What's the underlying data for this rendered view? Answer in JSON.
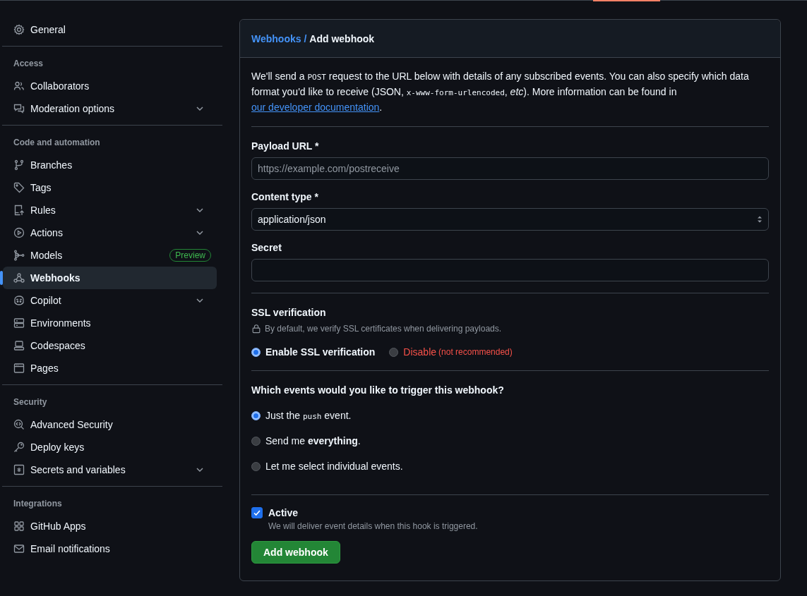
{
  "sidebar": {
    "sections": [
      {
        "items": [
          {
            "label": "General",
            "expandable": false,
            "selected": false
          }
        ]
      },
      {
        "heading": "Access",
        "items": [
          {
            "label": "Collaborators",
            "expandable": false,
            "selected": false
          },
          {
            "label": "Moderation options",
            "expandable": true,
            "selected": false
          }
        ]
      },
      {
        "heading": "Code and automation",
        "items": [
          {
            "label": "Branches",
            "expandable": false,
            "selected": false
          },
          {
            "label": "Tags",
            "expandable": false,
            "selected": false
          },
          {
            "label": "Rules",
            "expandable": true,
            "selected": false
          },
          {
            "label": "Actions",
            "expandable": true,
            "selected": false
          },
          {
            "label": "Models",
            "expandable": false,
            "selected": false,
            "badge": "Preview"
          },
          {
            "label": "Webhooks",
            "expandable": false,
            "selected": true
          },
          {
            "label": "Copilot",
            "expandable": true,
            "selected": false
          },
          {
            "label": "Environments",
            "expandable": false,
            "selected": false
          },
          {
            "label": "Codespaces",
            "expandable": false,
            "selected": false
          },
          {
            "label": "Pages",
            "expandable": false,
            "selected": false
          }
        ]
      },
      {
        "heading": "Security",
        "items": [
          {
            "label": "Advanced Security",
            "expandable": false,
            "selected": false
          },
          {
            "label": "Deploy keys",
            "expandable": false,
            "selected": false
          },
          {
            "label": "Secrets and variables",
            "expandable": true,
            "selected": false
          }
        ]
      },
      {
        "heading": "Integrations",
        "items": [
          {
            "label": "GitHub Apps",
            "expandable": false,
            "selected": false
          },
          {
            "label": "Email notifications",
            "expandable": false,
            "selected": false
          }
        ]
      }
    ]
  },
  "main": {
    "breadcrumb": {
      "parent": "Webhooks /",
      "current": "Add webhook"
    },
    "intro": [
      {
        "kind": "text",
        "text": "We'll send a "
      },
      {
        "kind": "code",
        "text": "POST"
      },
      {
        "kind": "text",
        "text": " request to the URL below with details of any subscribed events. You can also specify which data format you'd like to receive (JSON, "
      },
      {
        "kind": "code",
        "text": "x-www-form-urlencoded"
      },
      {
        "kind": "text",
        "text": ", "
      },
      {
        "kind": "italic",
        "text": "etc"
      },
      {
        "kind": "text",
        "text": "). More information can be found in "
      },
      {
        "kind": "link",
        "text": "our developer documentation"
      },
      {
        "kind": "text",
        "text": "."
      }
    ],
    "payload_url": {
      "label": "Payload URL *",
      "placeholder": "https://example.com/postreceive"
    },
    "content_type": {
      "label": "Content type *",
      "value": "application/json"
    },
    "secret": {
      "label": "Secret"
    },
    "ssl": {
      "heading": "SSL verification",
      "note": "By default, we verify SSL certificates when delivering payloads.",
      "options": [
        {
          "label": "Enable SSL verification",
          "kind": "normal",
          "selected": true
        },
        {
          "label": "Disable",
          "note": "(not recommended)",
          "kind": "danger",
          "selected": false
        }
      ]
    },
    "events": {
      "heading": "Which events would you like to trigger this webhook?",
      "options": [
        {
          "selected": true,
          "parts": [
            {
              "kind": "text",
              "text": "Just the "
            },
            {
              "kind": "code",
              "text": "push"
            },
            {
              "kind": "text",
              "text": " event."
            }
          ]
        },
        {
          "selected": false,
          "parts": [
            {
              "kind": "text",
              "text": "Send me "
            },
            {
              "kind": "bold",
              "text": "everything"
            },
            {
              "kind": "text",
              "text": "."
            }
          ]
        },
        {
          "selected": false,
          "parts": [
            {
              "kind": "text",
              "text": "Let me select individual events."
            }
          ]
        }
      ]
    },
    "active": {
      "label": "Active",
      "checked": true,
      "note": "We will deliver event details when this hook is triggered."
    },
    "submit": "Add webhook"
  }
}
